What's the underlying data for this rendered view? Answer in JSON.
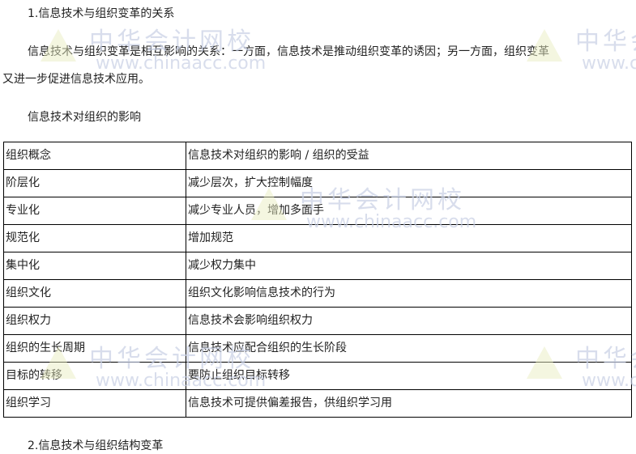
{
  "heading1": "1.信息技术与组织变革的关系",
  "para1_line1": "信息技术与组织变革是相互影响的关系：一方面，信息技术是推动组织变革的诱因；另一方面，组织变革",
  "para1_line2": "又进一步促进信息技术应用。",
  "table_caption": "信息技术对组织的影响",
  "table": {
    "rows": [
      [
        "组织概念",
        "信息技术对组织的影响 / 组织的受益"
      ],
      [
        "阶层化",
        "减少层次，扩大控制幅度"
      ],
      [
        "专业化",
        "减少专业人员，增加多面手"
      ],
      [
        "规范化",
        "增加规范"
      ],
      [
        "集中化",
        "减少权力集中"
      ],
      [
        "组织文化",
        "组织文化影响信息技术的行为"
      ],
      [
        "组织权力",
        "信息技术会影响组织权力"
      ],
      [
        "组织的生长周期",
        "信息技术应配合组织的生长阶段"
      ],
      [
        "目标的转移",
        "要防止组织目标转移"
      ],
      [
        "组织学习",
        "信息技术可提供偏差报告，供组织学习用"
      ]
    ]
  },
  "heading2": "2.信息技术与组织结构变革",
  "watermark": {
    "cn": "中华会计网校",
    "en": "www.chinaacc.com"
  }
}
